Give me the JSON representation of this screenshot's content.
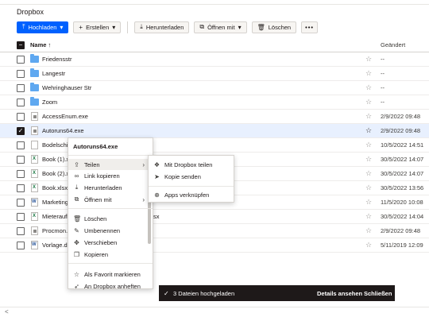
{
  "page_title": "Dropbox",
  "toolbar": {
    "upload_label": "Hochladen",
    "create_label": "Erstellen",
    "download_label": "Herunterladen",
    "open_with_label": "Öffnen mit",
    "delete_label": "Löschen",
    "more_label": "•••"
  },
  "table": {
    "col_name": "Name",
    "col_sort": "↑",
    "col_changed": "Geändert"
  },
  "files": [
    {
      "name": "Friedensstr",
      "date": "--",
      "type": "folder"
    },
    {
      "name": "Langestr",
      "date": "--",
      "type": "folder"
    },
    {
      "name": "Wehringhauser Str",
      "date": "--",
      "type": "folder"
    },
    {
      "name": "Zoom",
      "date": "--",
      "type": "folder"
    },
    {
      "name": "AccessEnum.exe",
      "date": "2/9/2022 09:48",
      "type": "exe"
    },
    {
      "name": "Autoruns64.exe",
      "date": "2/9/2022 09:48",
      "type": "exe",
      "selected": true
    },
    {
      "name": "Bodelschi",
      "date": "10/5/2022 14:51",
      "type": "doc"
    },
    {
      "name": "Book (1).xl",
      "date": "30/5/2022 14:07",
      "type": "xls"
    },
    {
      "name": "Book (2).xl",
      "date": "30/5/2022 14:07",
      "type": "xls"
    },
    {
      "name": "Book.xlsx",
      "date": "30/5/2022 13:56",
      "type": "xls"
    },
    {
      "name": "Marketing",
      "date": "11/5/2020 10:08",
      "type": "word"
    },
    {
      "name": "Mieteraufl",
      "name_tail": "sx",
      "date": "30/5/2022 14:04",
      "type": "xls"
    },
    {
      "name": "Procmon.e",
      "date": "2/9/2022 09:48",
      "type": "exe"
    },
    {
      "name": "Vorlage.do",
      "date": "5/11/2019 12:09",
      "type": "word"
    }
  ],
  "context_menu": {
    "title": "Autoruns64.exe",
    "items": [
      {
        "label": "Teilen",
        "icon": "share-icon",
        "glyph": "⇪",
        "chevron": "›"
      },
      {
        "label": "Link kopieren",
        "icon": "link-icon",
        "glyph": "∞"
      },
      {
        "label": "Herunterladen",
        "icon": "download-icon",
        "glyph": "⤓"
      },
      {
        "label": "Öffnen mit",
        "icon": "open-with-icon",
        "glyph": "⧉",
        "chevron": "›"
      },
      {
        "label": "Löschen",
        "icon": "trash-icon",
        "glyph": "🗑"
      },
      {
        "label": "Umbenennen",
        "icon": "rename-icon",
        "glyph": "✎"
      },
      {
        "label": "Verschieben",
        "icon": "move-icon",
        "glyph": "✥"
      },
      {
        "label": "Kopieren",
        "icon": "copy-icon",
        "glyph": "❐"
      },
      {
        "label": "Als Favorit markieren",
        "icon": "star-icon",
        "glyph": "☆"
      },
      {
        "label": "An Dropbox anheften",
        "icon": "pin-icon",
        "glyph": "➶"
      }
    ]
  },
  "submenu": {
    "items": [
      {
        "label": "Mit Dropbox teilen",
        "icon": "dropbox-icon",
        "glyph": "❖"
      },
      {
        "label": "Kopie senden",
        "icon": "send-icon",
        "glyph": "➤"
      },
      {
        "label": "Apps verknüpfen",
        "icon": "apps-icon",
        "glyph": "⊕"
      }
    ]
  },
  "toast": {
    "message": "3 Dateien hochgeladen",
    "details_label": "Details ansehen",
    "close_label": "Schließen"
  },
  "colors": {
    "accent": "#0061fe",
    "selected_row": "#e8f0fe",
    "folder": "#5fa8f0",
    "toast_bg": "#1e1919"
  }
}
